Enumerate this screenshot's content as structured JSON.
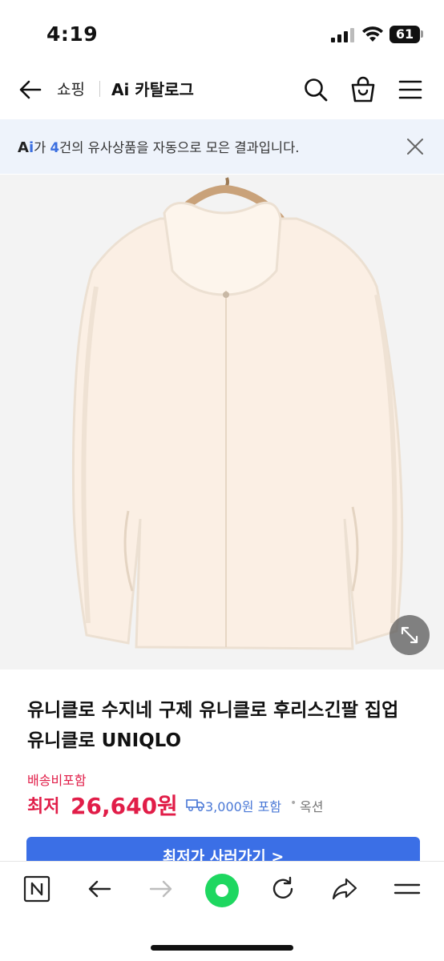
{
  "status_bar": {
    "time": "4:19",
    "battery": "61"
  },
  "nav": {
    "shop": "쇼핑",
    "title": "Ai 카탈로그"
  },
  "ai_banner": {
    "mark_a": "A",
    "mark_i": "i",
    "prefix": "가 ",
    "count": "4",
    "suffix": "건의 유사상품을 자동으로 모은 결과입니다."
  },
  "product": {
    "title": "유니클로 수지네 구제 유니클로 후리스긴팔 집업 유니클로 UNIQLO",
    "shipping_label": "배송비포함",
    "price_prefix": "최저",
    "price": "26,640원",
    "shipping_fee": "3,000원 포함",
    "separator": "•",
    "seller": "옥션",
    "buy_label": "최저가 사러가기 >"
  },
  "colors": {
    "accent_red": "#e11d48",
    "accent_blue": "#3b6fe6",
    "banner_bg": "#eef3fb"
  },
  "icons": [
    "back-arrow-icon",
    "search-icon",
    "shopping-bag-icon",
    "menu-icon",
    "close-icon",
    "expand-icon",
    "truck-icon",
    "naver-icon",
    "browser-back-icon",
    "browser-forward-icon",
    "green-dot-icon",
    "refresh-icon",
    "share-icon",
    "browser-menu-icon"
  ]
}
